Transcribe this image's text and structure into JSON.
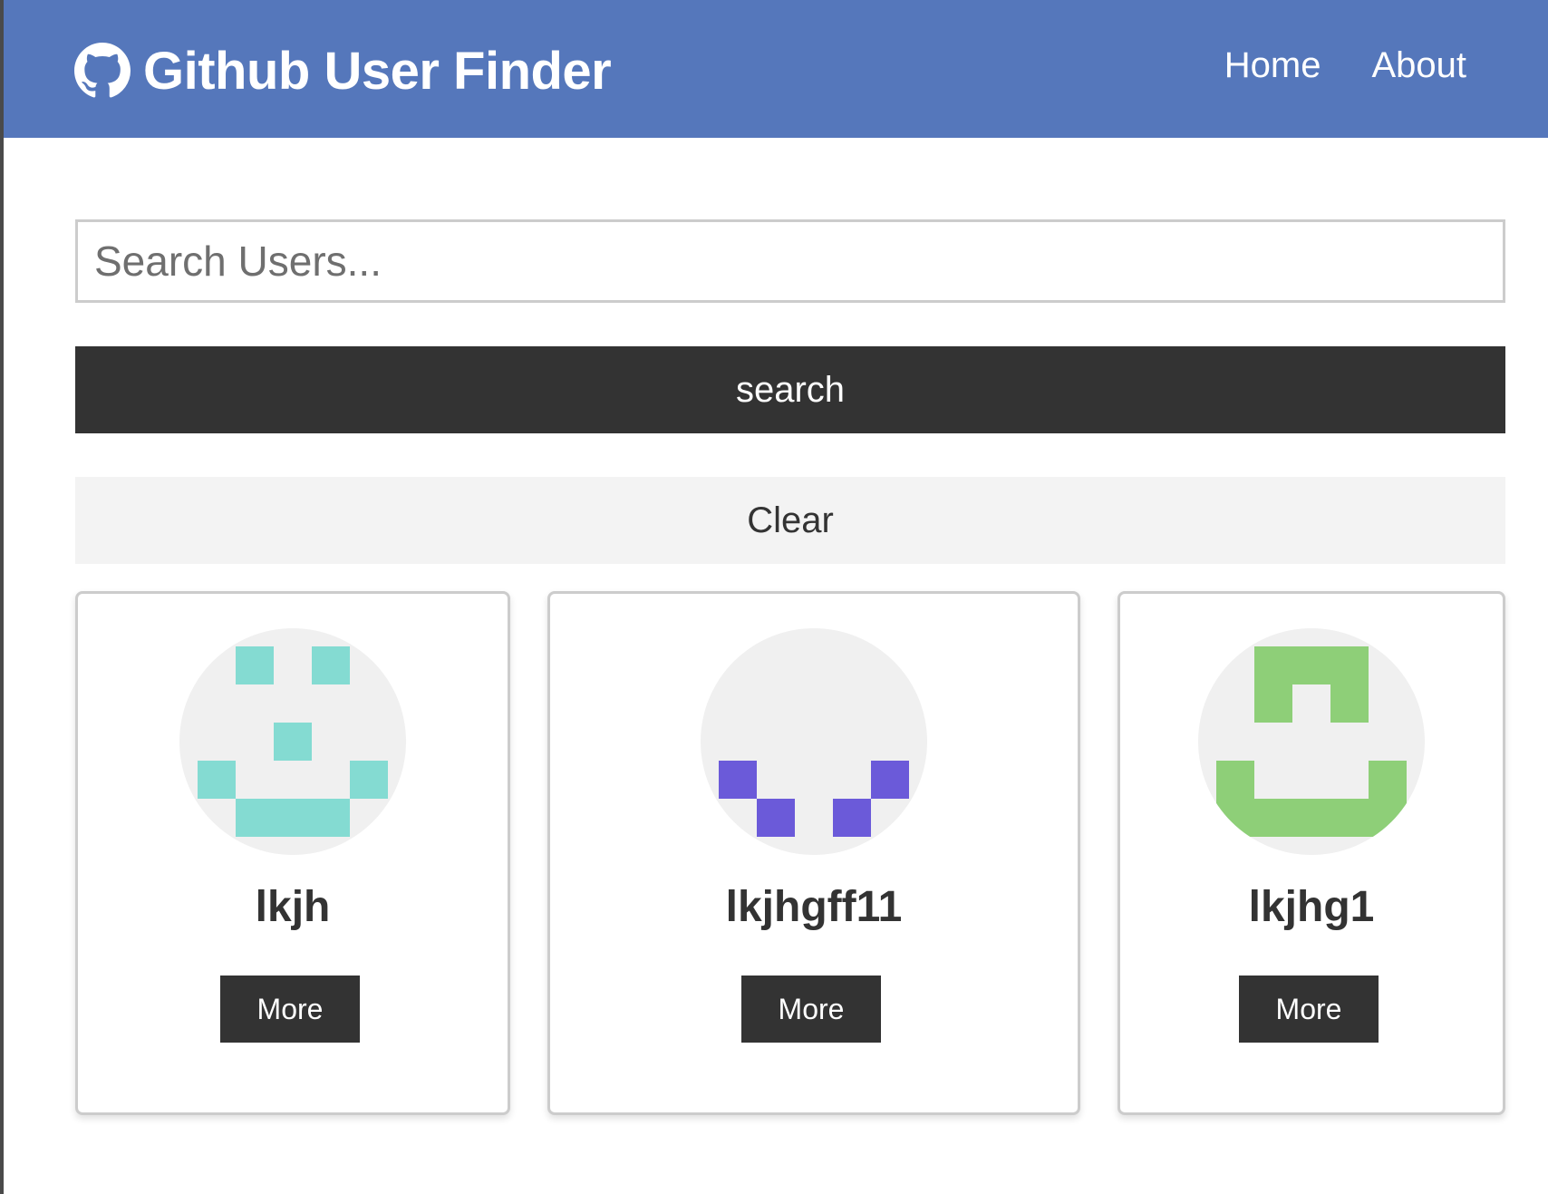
{
  "navbar": {
    "title": "Github User Finder",
    "brand_icon": "github-icon",
    "links": [
      {
        "label": "Home"
      },
      {
        "label": "About"
      }
    ],
    "bg_color": "#5577bb"
  },
  "search": {
    "placeholder": "Search Users...",
    "value": "",
    "search_label": "search",
    "clear_label": "Clear"
  },
  "users": [
    {
      "login": "lkjh",
      "more_label": "More",
      "avatar_icon": "identicon-teal",
      "avatar_color": "#84dbd2"
    },
    {
      "login": "lkjhgff11",
      "more_label": "More",
      "avatar_icon": "identicon-purple",
      "avatar_color": "#6b5ad9"
    },
    {
      "login": "lkjhg1",
      "more_label": "More",
      "avatar_icon": "identicon-green",
      "avatar_color": "#8ecf78"
    }
  ]
}
